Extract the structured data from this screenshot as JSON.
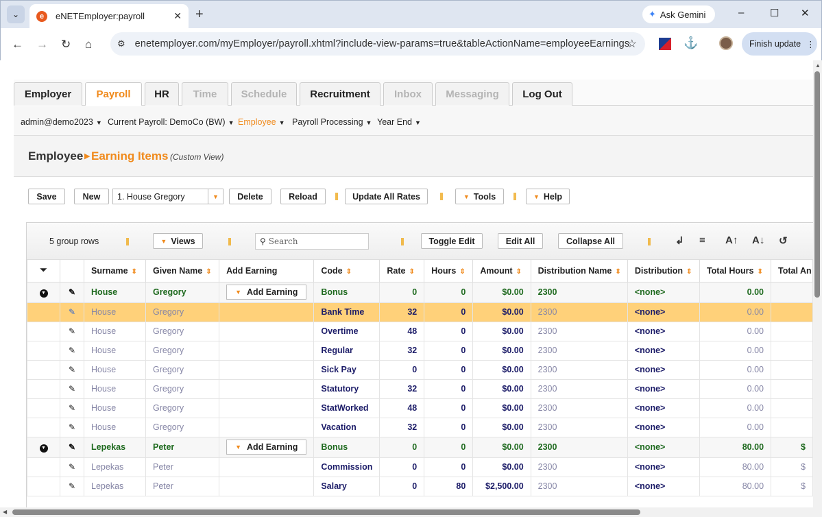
{
  "browser": {
    "tab_title": "eNETEmployer:payroll",
    "url": "enetemployer.com/myEmployer/payroll.xhtml?include-view-params=true&tableActionName=employeeEarnings",
    "gemini_label": "Ask Gemini",
    "finish_update_label": "Finish update"
  },
  "app_tabs": [
    {
      "label": "Employer",
      "state": "normal"
    },
    {
      "label": "Payroll",
      "state": "active"
    },
    {
      "label": "HR",
      "state": "normal"
    },
    {
      "label": "Time",
      "state": "disabled"
    },
    {
      "label": "Schedule",
      "state": "disabled"
    },
    {
      "label": "Recruitment",
      "state": "normal"
    },
    {
      "label": "Inbox",
      "state": "disabled"
    },
    {
      "label": "Messaging",
      "state": "disabled"
    },
    {
      "label": "Log Out",
      "state": "normal"
    }
  ],
  "submenu": {
    "user": "admin@demo2023",
    "current_payroll": "Current Payroll: DemoCo (BW)",
    "employee": "Employee",
    "processing": "Payroll Processing",
    "year_end": "Year End"
  },
  "breadcrumb": {
    "parent": "Employee",
    "current": "Earning Items",
    "view": "(Custom View)"
  },
  "actions": {
    "save": "Save",
    "new": "New",
    "employee_select": "1. House Gregory",
    "delete": "Delete",
    "reload": "Reload",
    "update_rates": "Update All Rates",
    "tools": "Tools",
    "help": "Help"
  },
  "grid": {
    "group_count": "5 group rows",
    "views": "Views",
    "search_placeholder": "Search",
    "toggle_edit": "Toggle Edit",
    "edit_all": "Edit All",
    "collapse_all": "Collapse All",
    "columns": [
      "Surname",
      "Given Name",
      "Add Earning",
      "Code",
      "Rate",
      "Hours",
      "Amount",
      "Distribution Name",
      "Distribution",
      "Total Hours",
      "Total An"
    ],
    "add_earning_label": "Add Earning",
    "rows": [
      {
        "type": "group",
        "surname": "House",
        "given": "Gregory",
        "code": "Bonus",
        "rate": "0",
        "hours": "0",
        "amount": "$0.00",
        "dist_name": "2300",
        "dist": "<none>",
        "total_hours": "0.00",
        "total_amt": ""
      },
      {
        "type": "row",
        "selected": true,
        "surname": "House",
        "given": "Gregory",
        "code": "Bank Time",
        "rate": "32",
        "hours": "0",
        "amount": "$0.00",
        "dist_name": "2300",
        "dist": "<none>",
        "total_hours": "0.00",
        "total_amt": ""
      },
      {
        "type": "row",
        "surname": "House",
        "given": "Gregory",
        "code": "Overtime",
        "rate": "48",
        "hours": "0",
        "amount": "$0.00",
        "dist_name": "2300",
        "dist": "<none>",
        "total_hours": "0.00",
        "total_amt": ""
      },
      {
        "type": "row",
        "surname": "House",
        "given": "Gregory",
        "code": "Regular",
        "rate": "32",
        "hours": "0",
        "amount": "$0.00",
        "dist_name": "2300",
        "dist": "<none>",
        "total_hours": "0.00",
        "total_amt": ""
      },
      {
        "type": "row",
        "surname": "House",
        "given": "Gregory",
        "code": "Sick Pay",
        "rate": "0",
        "hours": "0",
        "amount": "$0.00",
        "dist_name": "2300",
        "dist": "<none>",
        "total_hours": "0.00",
        "total_amt": ""
      },
      {
        "type": "row",
        "surname": "House",
        "given": "Gregory",
        "code": "Statutory",
        "rate": "32",
        "hours": "0",
        "amount": "$0.00",
        "dist_name": "2300",
        "dist": "<none>",
        "total_hours": "0.00",
        "total_amt": ""
      },
      {
        "type": "row",
        "surname": "House",
        "given": "Gregory",
        "code": "StatWorked",
        "rate": "48",
        "hours": "0",
        "amount": "$0.00",
        "dist_name": "2300",
        "dist": "<none>",
        "total_hours": "0.00",
        "total_amt": ""
      },
      {
        "type": "row",
        "surname": "House",
        "given": "Gregory",
        "code": "Vacation",
        "rate": "32",
        "hours": "0",
        "amount": "$0.00",
        "dist_name": "2300",
        "dist": "<none>",
        "total_hours": "0.00",
        "total_amt": ""
      },
      {
        "type": "group",
        "surname": "Lepekas",
        "given": "Peter",
        "code": "Bonus",
        "rate": "0",
        "hours": "0",
        "amount": "$0.00",
        "dist_name": "2300",
        "dist": "<none>",
        "total_hours": "80.00",
        "total_amt": "$"
      },
      {
        "type": "row",
        "surname": "Lepekas",
        "given": "Peter",
        "code": "Commission",
        "rate": "0",
        "hours": "0",
        "amount": "$0.00",
        "dist_name": "2300",
        "dist": "<none>",
        "total_hours": "80.00",
        "total_amt": "$"
      },
      {
        "type": "row",
        "surname": "Lepekas",
        "given": "Peter",
        "code": "Salary",
        "rate": "0",
        "hours": "80",
        "amount": "$2,500.00",
        "dist_name": "2300",
        "dist": "<none>",
        "total_hours": "80.00",
        "total_amt": "$"
      }
    ]
  },
  "colors": {
    "accent": "#f08a1c",
    "selected_row": "#ffd17a",
    "group_text": "#1f6a1f",
    "code_text": "#1c1c68"
  },
  "icons": [
    "chevron-down-icon",
    "close-icon",
    "plus-icon",
    "back-icon",
    "forward-icon",
    "reload-icon",
    "home-icon",
    "tune-icon",
    "star-icon",
    "puzzle-icon",
    "filter-icon",
    "collapse-icon",
    "pencil-icon",
    "search-icon",
    "wrap-icon",
    "clear-format-icon",
    "font-increase-icon",
    "font-decrease-icon",
    "refresh-icon"
  ]
}
